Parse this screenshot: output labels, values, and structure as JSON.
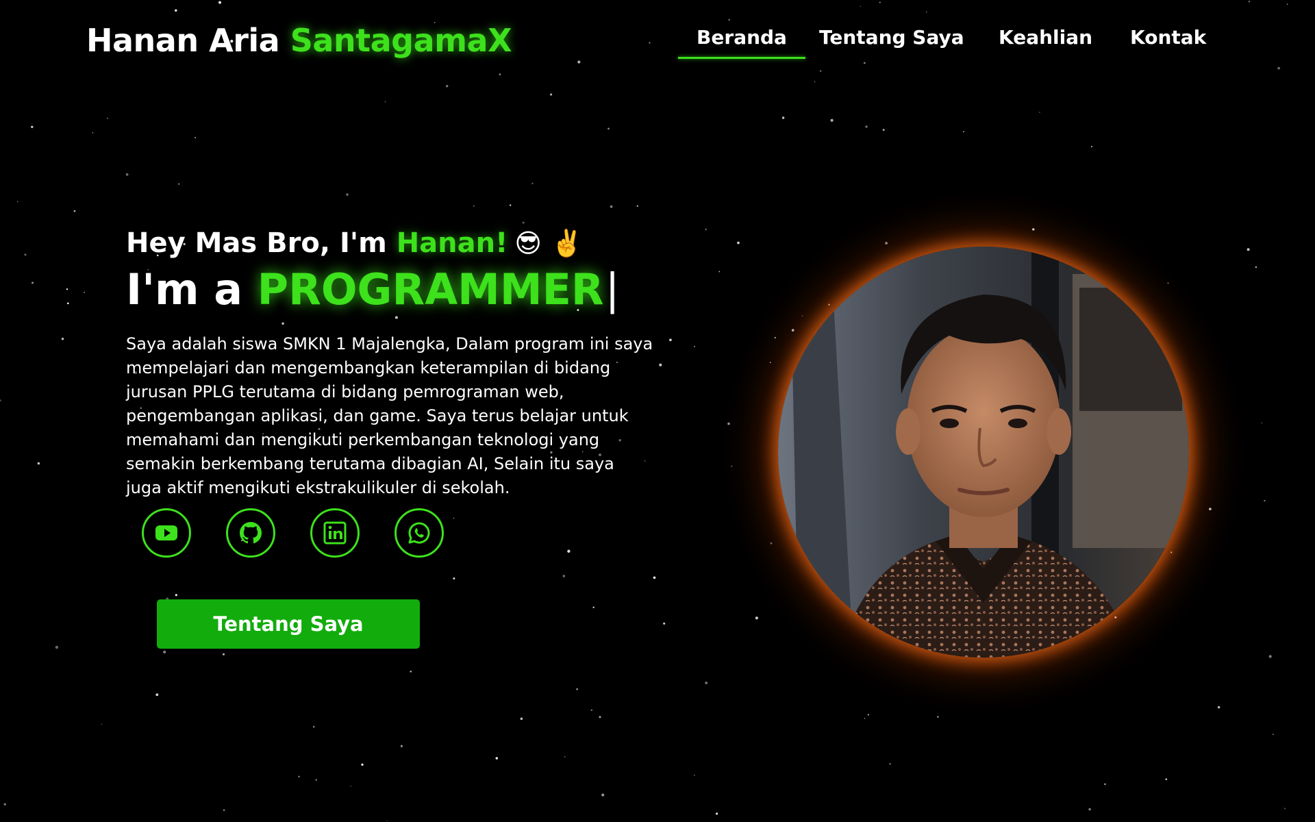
{
  "header": {
    "logo_first": "Hanan Aria ",
    "logo_accent": "SantagamaX",
    "nav": [
      {
        "label": "Beranda",
        "active": true
      },
      {
        "label": "Tentang Saya",
        "active": false
      },
      {
        "label": "Keahlian",
        "active": false
      },
      {
        "label": "Kontak",
        "active": false
      }
    ]
  },
  "hero": {
    "greeting_prefix": "Hey Mas Bro, I'm ",
    "greeting_name": "Hanan!",
    "greeting_emoji": "😎 ✌️",
    "role_prefix": "I'm a ",
    "role_value": "PROGRAMMER",
    "caret": "|",
    "bio": "Saya adalah siswa SMKN 1 Majalengka, Dalam program ini saya mempelajari dan mengembangkan keterampilan di bidang jurusan PPLG terutama di bidang pemrograman web, pengembangan aplikasi, dan game. Saya terus belajar untuk memahami dan mengikuti perkembangan teknologi yang semakin berkembang terutama dibagian AI, Selain itu saya juga aktif mengikuti ekstrakulikuler di sekolah.",
    "socials": [
      {
        "icon": "youtube-icon"
      },
      {
        "icon": "github-icon"
      },
      {
        "icon": "linkedin-icon"
      },
      {
        "icon": "whatsapp-icon"
      }
    ],
    "cta_label": "Tentang Saya"
  },
  "portrait": {
    "subject": "profile photo of a young man"
  },
  "colors": {
    "accent": "#3de11c",
    "button": "#12ac0d",
    "background": "#000000",
    "portrait_glow": "#ff6e14"
  }
}
